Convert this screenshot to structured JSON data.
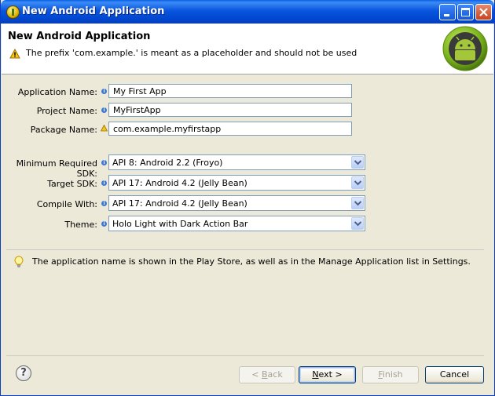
{
  "window": {
    "title": "New Android Application"
  },
  "header": {
    "title": "New Android Application",
    "message": "The prefix 'com.example.' is meant as a placeholder and should not be used",
    "message_icon": "warning-icon",
    "logo": "android-logo"
  },
  "fields": {
    "application_name": {
      "label": "Application Name:",
      "value": "My First App",
      "decoration": "info-icon"
    },
    "project_name": {
      "label": "Project Name:",
      "value": "MyFirstApp",
      "decoration": "info-icon"
    },
    "package_name": {
      "label": "Package Name:",
      "value": "com.example.myfirstapp",
      "decoration": "warning-icon"
    }
  },
  "selects": {
    "min_sdk": {
      "label": "Minimum Required SDK:",
      "value": "API 8: Android 2.2 (Froyo)"
    },
    "target_sdk": {
      "label": "Target SDK:",
      "value": "API 17: Android 4.2 (Jelly Bean)"
    },
    "compile_with": {
      "label": "Compile With:",
      "value": "API 17: Android 4.2 (Jelly Bean)"
    },
    "theme": {
      "label": "Theme:",
      "value": "Holo Light with Dark Action Bar"
    }
  },
  "hint": {
    "icon": "lightbulb-icon",
    "text": "The application name is shown in the Play Store, as well as in the Manage Application list in Settings."
  },
  "buttons": {
    "help": "?",
    "back": {
      "prefix": "< ",
      "mnemonic": "B",
      "rest": "ack",
      "enabled": false
    },
    "next": {
      "mnemonic": "N",
      "rest": "ext >",
      "enabled": true
    },
    "finish": {
      "mnemonic": "F",
      "rest": "inish",
      "enabled": false
    },
    "cancel": {
      "label": "Cancel",
      "enabled": true
    }
  },
  "colors": {
    "titlebar": "#0a55de",
    "dialog_bg": "#ece9d8",
    "info_dot": "#3c78d8",
    "warning": "#f0c000"
  }
}
